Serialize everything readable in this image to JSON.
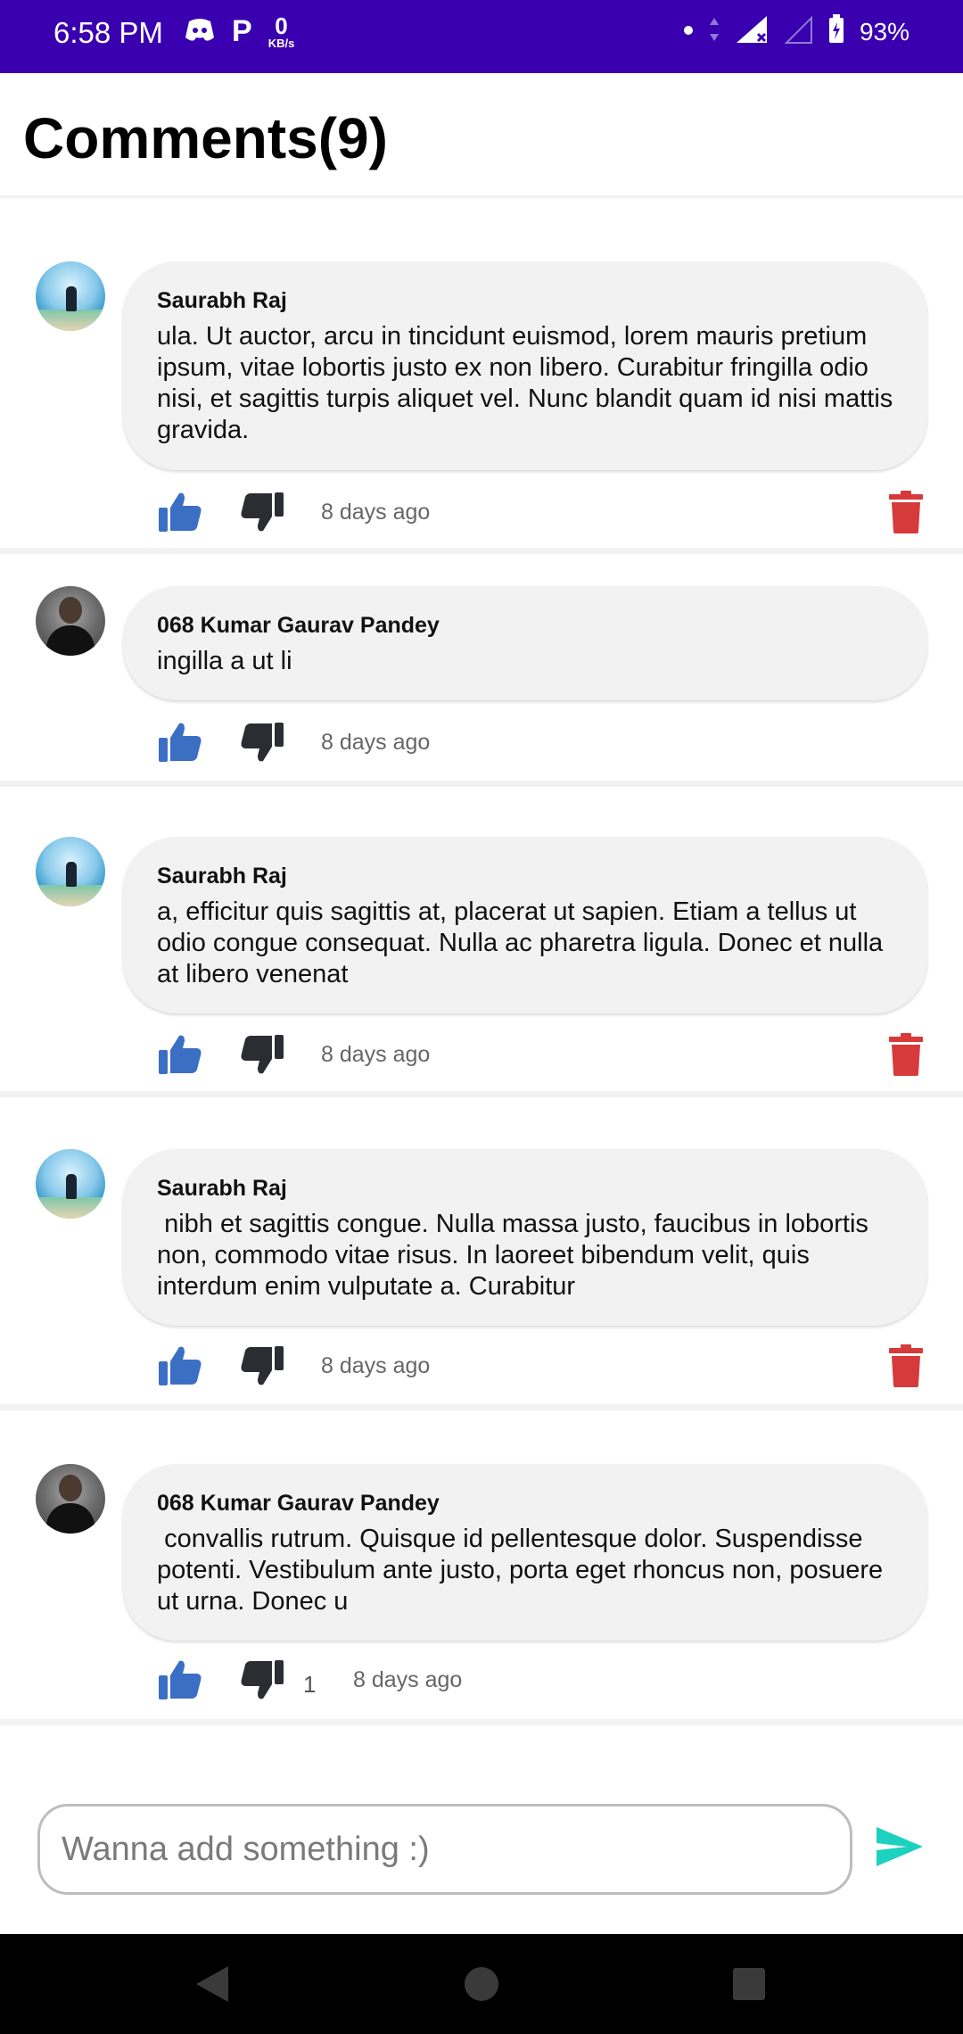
{
  "status_bar": {
    "time": "6:58 PM",
    "speed_value": "0",
    "speed_unit": "KB/s",
    "p_icon": "P",
    "battery": "93%"
  },
  "header": {
    "title": "Comments(9)"
  },
  "comments": [
    {
      "author": "Saurabh Raj",
      "text": "ula. Ut auctor, arcu in tincidunt euismod, lorem mauris pretium ipsum, vitae lobortis justo ex non libero. Curabitur fringilla odio nisi, et sagittis turpis aliquet vel. Nunc blandit quam id nisi mattis gravida.",
      "age": "8 days ago",
      "dislike_count": "",
      "deletable": true
    },
    {
      "author": "068 Kumar Gaurav Pandey",
      "text": "ingilla a ut li",
      "age": "8 days ago",
      "dislike_count": "",
      "deletable": false
    },
    {
      "author": "Saurabh Raj",
      "text": "a, efficitur quis sagittis at, placerat ut sapien. Etiam a tellus ut odio congue consequat. Nulla ac pharetra ligula. Donec et nulla at libero venenat",
      "age": "8 days ago",
      "dislike_count": "",
      "deletable": true
    },
    {
      "author": "Saurabh Raj",
      "text": " nibh et sagittis congue. Nulla massa justo, faucibus in lobortis non, commodo vitae risus. In laoreet bibendum velit, quis interdum enim vulputate a. Curabitur",
      "age": "8 days ago",
      "dislike_count": "",
      "deletable": true
    },
    {
      "author": "068 Kumar Gaurav Pandey",
      "text": " convallis rutrum. Quisque id pellentesque dolor. Suspendisse potenti. Vestibulum ante justo, porta eget rhoncus non, posuere ut urna. Donec u",
      "age": "8 days ago",
      "dislike_count": "1",
      "deletable": false
    }
  ],
  "composer": {
    "placeholder": "Wanna add something :)"
  },
  "colors": {
    "status_bar": "#3a00b0",
    "like": "#3b6fc4",
    "dislike": "#2b2d33",
    "delete": "#d63a3a",
    "send": "#1dd1c1"
  },
  "icons": {
    "like": "thumbs-up-icon",
    "dislike": "thumbs-down-icon",
    "delete": "trash-icon",
    "send": "send-icon"
  }
}
